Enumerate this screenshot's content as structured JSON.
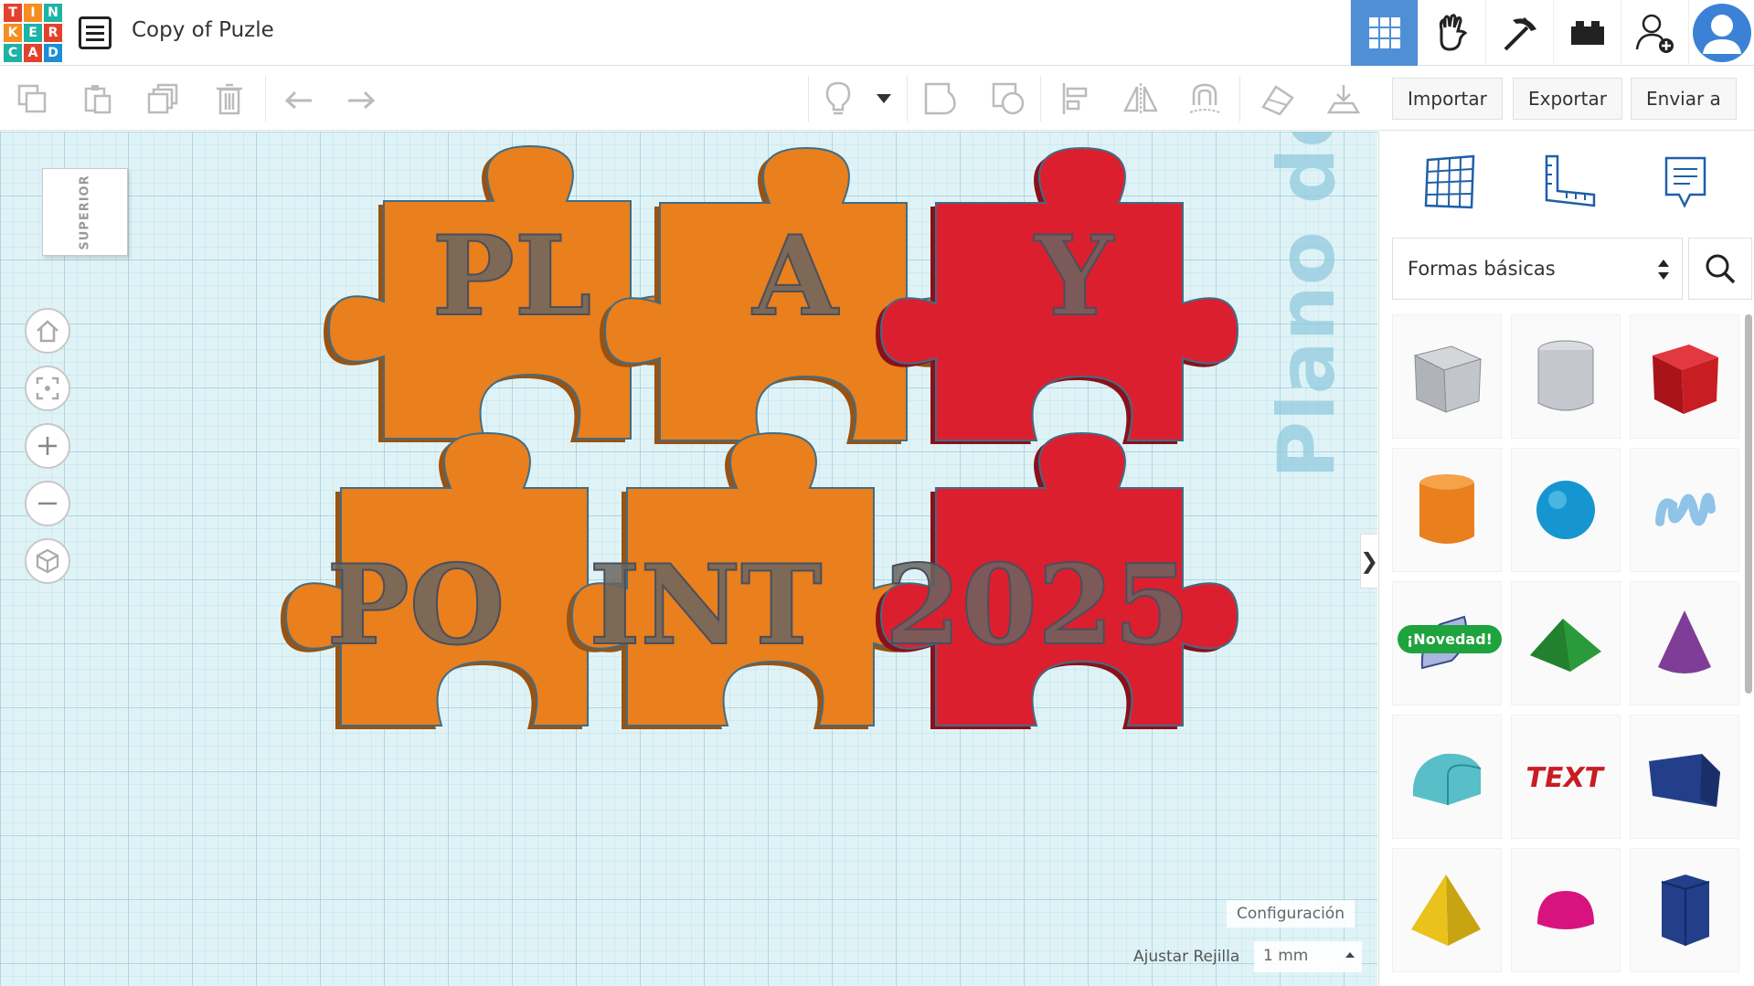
{
  "app": {
    "logo_letters": [
      "T",
      "I",
      "N",
      "K",
      "E",
      "R",
      "C",
      "A",
      "D"
    ],
    "logo_colors": [
      "#e2422c",
      "#f58d23",
      "#1db3a5",
      "#f58d23",
      "#1db3a5",
      "#e2422c",
      "#1db3a5",
      "#e2422c",
      "#1a8fd6"
    ],
    "design_title": "Copy of Puzle"
  },
  "topnav": {
    "items": [
      {
        "name": "3d-design-view",
        "icon": "grid-icon",
        "active": true
      },
      {
        "name": "circuits-view",
        "icon": "hand-icon",
        "active": false
      },
      {
        "name": "codeblocks-view",
        "icon": "pickaxe-icon",
        "active": false
      },
      {
        "name": "bricks-view",
        "icon": "brick-icon",
        "active": false
      },
      {
        "name": "invite-user",
        "icon": "add-user-icon",
        "active": false
      },
      {
        "name": "profile",
        "icon": "avatar-icon",
        "active": false
      }
    ],
    "accent": "#4f8fd6"
  },
  "toolbar": {
    "import_label": "Importar",
    "export_label": "Exportar",
    "send_label": "Enviar a",
    "tools": [
      "copy-icon",
      "paste-icon",
      "duplicate-icon",
      "delete-icon",
      "undo-icon",
      "redo-icon",
      "lightbulb-icon",
      "dropdown-icon",
      "group-icon",
      "ungroup-icon",
      "align-icon",
      "mirror-icon",
      "magnet-icon",
      "cruise-icon",
      "drop-icon"
    ]
  },
  "workplane": {
    "viewcube_label": "SUPERIOR",
    "plane_label": "Plano de trabajo",
    "config_label": "Configuración",
    "snap_label": "Ajustar Rejilla",
    "snap_value": "1 mm",
    "nav_controls": [
      "home-icon",
      "fit-icon",
      "zoom-in-icon",
      "zoom-out-icon",
      "ortho-icon"
    ],
    "pieces": [
      {
        "text": "PL",
        "color": "#e97f1d"
      },
      {
        "text": "A",
        "color": "#e97f1d"
      },
      {
        "text": "Y",
        "color": "#dc1f2e"
      },
      {
        "text": "PO",
        "color": "#e97f1d"
      },
      {
        "text": "INT",
        "color": "#e97f1d"
      },
      {
        "text": "2025",
        "color": "#dc1f2e"
      }
    ]
  },
  "panel": {
    "tools": [
      "workplane-icon",
      "ruler-icon",
      "notes-icon"
    ],
    "shape_category": "Formas básicas",
    "new_badge": "¡Novedad!",
    "shapes": [
      {
        "name": "box-hole",
        "color": "#b9bcc2"
      },
      {
        "name": "cylinder-hole",
        "color": "#c9ccd2"
      },
      {
        "name": "box",
        "color": "#d21c24"
      },
      {
        "name": "cylinder",
        "color": "#e97f1d"
      },
      {
        "name": "sphere",
        "color": "#1596d0"
      },
      {
        "name": "scribble",
        "color": "#8fc3e8"
      },
      {
        "name": "shape-generator",
        "color": "#a9b6df"
      },
      {
        "name": "roof",
        "color": "#2b9a3a"
      },
      {
        "name": "cone",
        "color": "#7f3d97"
      },
      {
        "name": "round-roof",
        "color": "#58bfc9"
      },
      {
        "name": "text",
        "color": "#c81d23"
      },
      {
        "name": "wedge",
        "color": "#233f8a"
      },
      {
        "name": "pyramid",
        "color": "#e9c21b"
      },
      {
        "name": "half-sphere",
        "color": "#d8137f"
      },
      {
        "name": "polygon",
        "color": "#233f8a"
      }
    ]
  }
}
